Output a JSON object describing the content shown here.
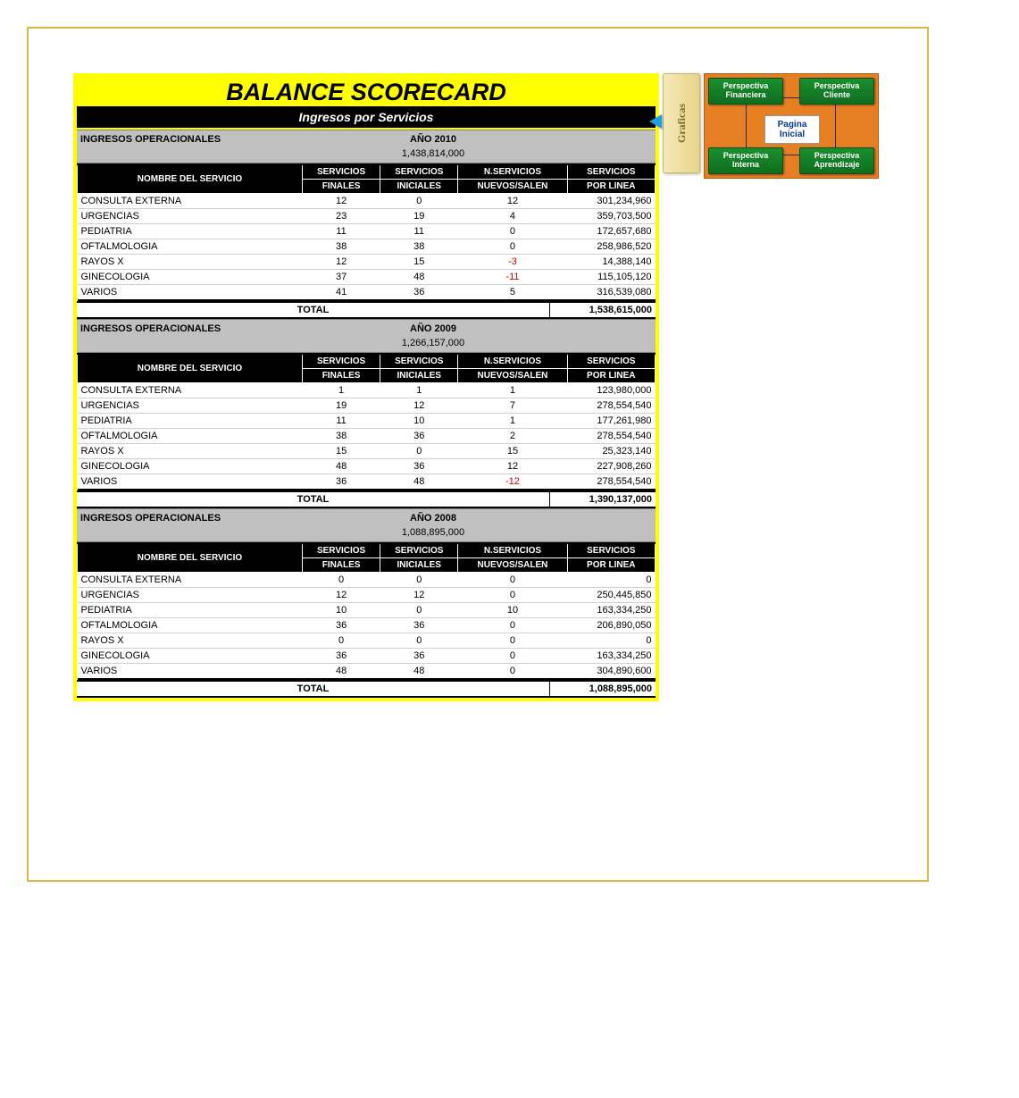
{
  "title": "BALANCE SCORECARD",
  "subtitle": "Ingresos por Servicios",
  "header_cols": {
    "nombre": "NOMBRE DEL SERVICIO",
    "finales_top": "SERVICIOS",
    "finales_bot": "FINALES",
    "iniciales_top": "SERVICIOS",
    "iniciales_bot": "INICIALES",
    "nuevos_top": "N.SERVICIOS",
    "nuevos_bot": "NUEVOS/SALEN",
    "linea_top": "SERVICIOS",
    "linea_bot": "POR LINEA"
  },
  "sections": [
    {
      "label": "INGRESOS OPERACIONALES",
      "year": "AÑO 2010",
      "amount": "1,438,814,000",
      "rows": [
        {
          "name": "CONSULTA EXTERNA",
          "finales": "12",
          "iniciales": "0",
          "nuevos": "12",
          "linea": "301,234,960"
        },
        {
          "name": "URGENCIAS",
          "finales": "23",
          "iniciales": "19",
          "nuevos": "4",
          "linea": "359,703,500"
        },
        {
          "name": "PEDIATRIA",
          "finales": "11",
          "iniciales": "11",
          "nuevos": "0",
          "linea": "172,657,680"
        },
        {
          "name": "OFTALMOLOGIA",
          "finales": "38",
          "iniciales": "38",
          "nuevos": "0",
          "linea": "258,986,520"
        },
        {
          "name": "RAYOS X",
          "finales": "12",
          "iniciales": "15",
          "nuevos": "-3",
          "linea": "14,388,140"
        },
        {
          "name": "GINECOLOGIA",
          "finales": "37",
          "iniciales": "48",
          "nuevos": "-11",
          "linea": "115,105,120"
        },
        {
          "name": "VARIOS",
          "finales": "41",
          "iniciales": "36",
          "nuevos": "5",
          "linea": "316,539,080"
        }
      ],
      "total_label": "TOTAL",
      "total": "1,538,615,000"
    },
    {
      "label": "INGRESOS OPERACIONALES",
      "year": "AÑO 2009",
      "amount": "1,266,157,000",
      "rows": [
        {
          "name": "CONSULTA EXTERNA",
          "finales": "1",
          "iniciales": "1",
          "nuevos": "1",
          "linea": "123,980,000"
        },
        {
          "name": "URGENCIAS",
          "finales": "19",
          "iniciales": "12",
          "nuevos": "7",
          "linea": "278,554,540"
        },
        {
          "name": "PEDIATRIA",
          "finales": "11",
          "iniciales": "10",
          "nuevos": "1",
          "linea": "177,261,980"
        },
        {
          "name": "OFTALMOLOGIA",
          "finales": "38",
          "iniciales": "36",
          "nuevos": "2",
          "linea": "278,554,540"
        },
        {
          "name": "RAYOS X",
          "finales": "15",
          "iniciales": "0",
          "nuevos": "15",
          "linea": "25,323,140"
        },
        {
          "name": "GINECOLOGIA",
          "finales": "48",
          "iniciales": "36",
          "nuevos": "12",
          "linea": "227,908,260"
        },
        {
          "name": "VARIOS",
          "finales": "36",
          "iniciales": "48",
          "nuevos": "-12",
          "linea": "278,554,540"
        }
      ],
      "total_label": "TOTAL",
      "total": "1,390,137,000"
    },
    {
      "label": "INGRESOS OPERACIONALES",
      "year": "AÑO 2008",
      "amount": "1,088,895,000",
      "rows": [
        {
          "name": "CONSULTA EXTERNA",
          "finales": "0",
          "iniciales": "0",
          "nuevos": "0",
          "linea": "0"
        },
        {
          "name": "URGENCIAS",
          "finales": "12",
          "iniciales": "12",
          "nuevos": "0",
          "linea": "250,445,850"
        },
        {
          "name": "PEDIATRIA",
          "finales": "10",
          "iniciales": "0",
          "nuevos": "10",
          "linea": "163,334,250"
        },
        {
          "name": "OFTALMOLOGIA",
          "finales": "36",
          "iniciales": "36",
          "nuevos": "0",
          "linea": "206,890,050"
        },
        {
          "name": "RAYOS X",
          "finales": "0",
          "iniciales": "0",
          "nuevos": "0",
          "linea": "0"
        },
        {
          "name": "GINECOLOGIA",
          "finales": "36",
          "iniciales": "36",
          "nuevos": "0",
          "linea": "163,334,250"
        },
        {
          "name": "VARIOS",
          "finales": "48",
          "iniciales": "48",
          "nuevos": "0",
          "linea": "304,890,600"
        }
      ],
      "total_label": "TOTAL",
      "total": "1,088,895,000"
    }
  ],
  "side": {
    "graficas": "Graficas",
    "nav": {
      "tl": "Perspectiva\nFinanciera",
      "tr": "Perspectiva\nCliente",
      "bl": "Perspectiva\nInterna",
      "br": "Perspectiva\nAprendizaje",
      "center": "Pagina\nInicial"
    }
  }
}
